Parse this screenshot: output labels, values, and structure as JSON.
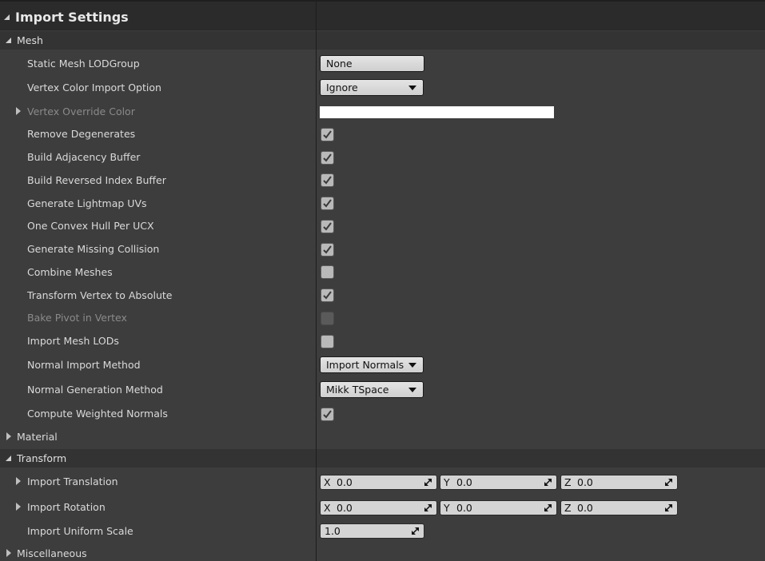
{
  "panel": {
    "title": "Import Settings"
  },
  "mesh": {
    "header": "Mesh",
    "static_mesh_lodgroup": {
      "label": "Static Mesh LODGroup",
      "value": "None"
    },
    "vertex_color_import_option": {
      "label": "Vertex Color Import Option",
      "value": "Ignore"
    },
    "vertex_override_color": {
      "label": "Vertex Override Color",
      "color": "#FFFFFF"
    },
    "remove_degenerates": {
      "label": "Remove Degenerates",
      "checked": true
    },
    "build_adjacency_buffer": {
      "label": "Build Adjacency Buffer",
      "checked": true
    },
    "build_reversed_index_buffer": {
      "label": "Build Reversed Index Buffer",
      "checked": true
    },
    "generate_lightmap_uvs": {
      "label": "Generate Lightmap UVs",
      "checked": true
    },
    "one_convex_hull_per_ucx": {
      "label": "One Convex Hull Per UCX",
      "checked": true
    },
    "generate_missing_collision": {
      "label": "Generate Missing Collision",
      "checked": true
    },
    "combine_meshes": {
      "label": "Combine Meshes",
      "checked": false
    },
    "transform_vertex_to_absolute": {
      "label": "Transform Vertex to Absolute",
      "checked": true
    },
    "bake_pivot_in_vertex": {
      "label": "Bake Pivot in Vertex",
      "checked": false,
      "disabled": true
    },
    "import_mesh_lods": {
      "label": "Import Mesh LODs",
      "checked": false
    },
    "normal_import_method": {
      "label": "Normal Import Method",
      "value": "Import Normals"
    },
    "normal_generation_method": {
      "label": "Normal Generation Method",
      "value": "Mikk TSpace"
    },
    "compute_weighted_normals": {
      "label": "Compute Weighted Normals",
      "checked": true
    }
  },
  "material": {
    "header": "Material"
  },
  "transform": {
    "header": "Transform",
    "import_translation": {
      "label": "Import Translation",
      "x_label": "X",
      "x": "0.0",
      "y_label": "Y",
      "y": "0.0",
      "z_label": "Z",
      "z": "0.0"
    },
    "import_rotation": {
      "label": "Import Rotation",
      "x_label": "X",
      "x": "0.0",
      "y_label": "Y",
      "y": "0.0",
      "z_label": "Z",
      "z": "0.0"
    },
    "import_uniform_scale": {
      "label": "Import Uniform Scale",
      "value": "1.0"
    }
  },
  "miscellaneous": {
    "header": "Miscellaneous"
  },
  "icons": {
    "expanded": "triangle-down-icon",
    "collapsed": "triangle-right-icon",
    "checkmark": "checkmark-icon",
    "dropdown": "dropdown-arrow-icon",
    "spin": "spin-arrows-icon"
  }
}
